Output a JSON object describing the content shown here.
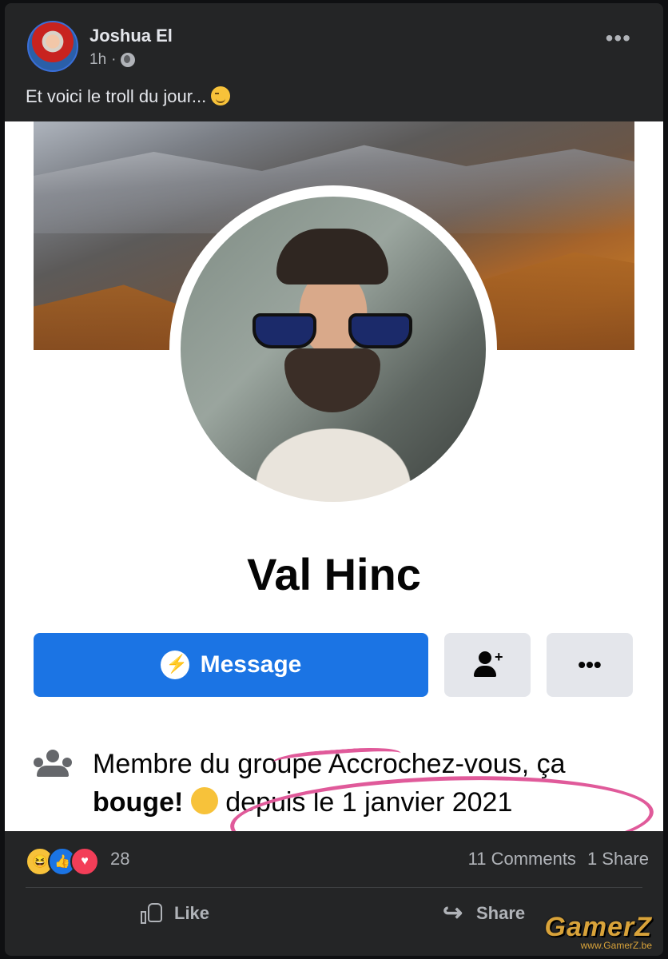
{
  "post": {
    "author": "Joshua El",
    "time": "1h",
    "separator": "·",
    "caption": "Et voici le troll du jour...",
    "more_icon": "more-dots-icon"
  },
  "screenshot": {
    "profile_name": "Val Hinc",
    "message_label": "Message",
    "more_label": "•••",
    "group_text_start": "Membre du gr",
    "group_text_scribbled": "oupe Accrochez-vous, ça",
    "group_text_bold": "bouge!",
    "group_text_end": "depuis le 1 janvier 2021",
    "accent_color": "#1b74e4",
    "annotation_color": "#e05a9a"
  },
  "stats": {
    "reaction_count": "28",
    "comments": "11 Comments",
    "shares": "1 Share",
    "reactions": [
      "haha",
      "like",
      "love"
    ]
  },
  "actions": {
    "like": "Like",
    "share": "Share"
  },
  "watermark": {
    "title": "GamerZ",
    "url": "www.GamerZ.be"
  }
}
